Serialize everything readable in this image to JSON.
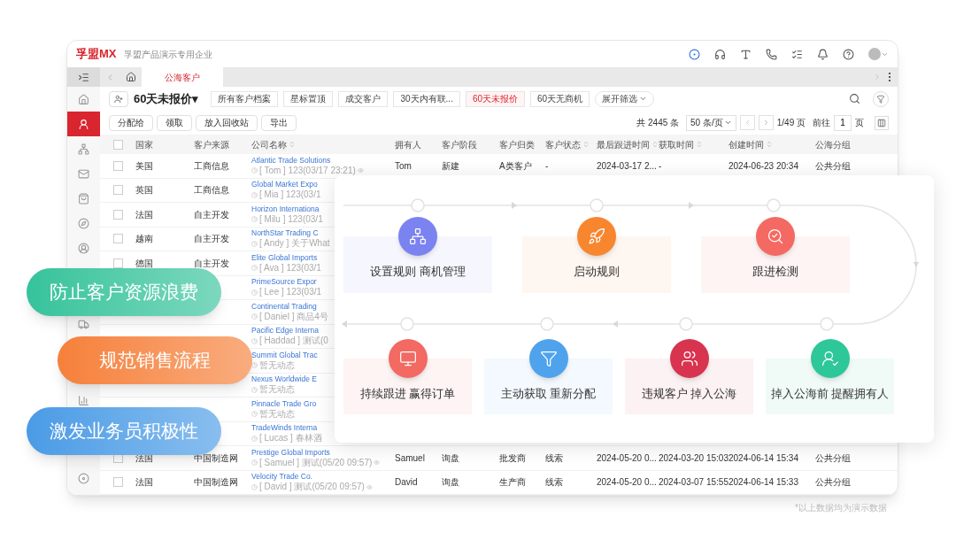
{
  "header": {
    "logo": "孚盟MX",
    "company": "孚盟产品演示专用企业"
  },
  "tabs": [
    {
      "label": "公海客户",
      "selected": true
    }
  ],
  "sidebar": {
    "items": [
      {
        "selected": false
      },
      {
        "selected": true
      },
      {
        "selected": false
      },
      {
        "selected": false
      },
      {
        "selected": false
      },
      {
        "selected": false
      },
      {
        "selected": false
      },
      {
        "selected": false
      },
      {
        "selected": false
      },
      {
        "selected": false
      }
    ]
  },
  "view": {
    "title": "60天未报价▾"
  },
  "chips": [
    {
      "label": "所有客户档案",
      "selected": false
    },
    {
      "label": "星标置顶",
      "selected": false
    },
    {
      "label": "成交客户",
      "selected": false
    },
    {
      "label": "30天内有联...",
      "selected": false
    },
    {
      "label": "60天未报价",
      "selected": true
    },
    {
      "label": "60天无商机",
      "selected": false
    }
  ],
  "expand_filter": "展开筛选",
  "actions": [
    "分配给",
    "领取",
    "放入回收站",
    "导出"
  ],
  "pagination": {
    "total": "共 2445 条",
    "per_page": "50 条/页",
    "pages": "1/49 页",
    "goto": "前往",
    "page": "1",
    "unit": "页"
  },
  "table": {
    "all_checked": false,
    "columns": [
      {
        "label": "国家",
        "sortable": false
      },
      {
        "label": "客户来源",
        "sortable": false
      },
      {
        "label": "公司名称",
        "sortable": true
      },
      {
        "label": "拥有人",
        "sortable": false
      },
      {
        "label": "客户阶段",
        "sortable": false
      },
      {
        "label": "客户归类",
        "sortable": false
      },
      {
        "label": "客户状态",
        "sortable": true
      },
      {
        "label": "最后跟进时间",
        "sortable": true
      },
      {
        "label": "获取时间",
        "sortable": true
      },
      {
        "label": "创建时间",
        "sortable": true
      },
      {
        "label": "公海分组",
        "sortable": false
      }
    ],
    "rows": [
      {
        "checked": false,
        "cells": [
          "美国",
          "工商信息",
          "Atlantic Trade Solutions",
          "Tom",
          "新建",
          "A类客户",
          "-",
          "2024-03-17 2...",
          "-",
          "2024-06-23 20:34",
          "公共分组"
        ],
        "note": "[ Tom ] 123(03/17 23:21)"
      },
      {
        "checked": false,
        "cells": [
          "英国",
          "工商信息",
          "Global Market Expo"
        ],
        "note": "[ Mia ] 123(03/1"
      },
      {
        "checked": false,
        "cells": [
          "法国",
          "自主开发",
          "Horizon Internationa"
        ],
        "note": "[ Milu ] 123(03/1"
      },
      {
        "checked": false,
        "cells": [
          "越南",
          "自主开发",
          "NorthStar Trading C"
        ],
        "note": "[ Andy ] 关于What"
      },
      {
        "checked": false,
        "cells": [
          "德国",
          "自主开发",
          "Elite Global Imports"
        ],
        "note": "[ Ava ] 123(03/1"
      },
      {
        "cells": [
          null,
          null,
          "PrimeSource Expor"
        ],
        "note": "[ Lee ] 123(03/1"
      },
      {
        "cells": [
          null,
          null,
          "Continental Trading"
        ],
        "note": "[ Daniel ] 商品4号"
      },
      {
        "cells": [
          null,
          null,
          "Pacific Edge Interna"
        ],
        "note": "[ Haddad ] 测试(0"
      },
      {
        "cells": [
          null,
          null,
          "Summit Global Trac"
        ],
        "note": "暂无动态"
      },
      {
        "cells": [
          null,
          null,
          "Nexus Worldwide E"
        ],
        "note": "暂无动态"
      },
      {
        "cells": [
          null,
          null,
          "Pinnacle Trade Gro"
        ],
        "note": "暂无动态"
      },
      {
        "cells": [
          null,
          null,
          "TradeWinds Interna"
        ],
        "note": "[ Lucas ] 春林酒"
      },
      {
        "checked": false,
        "cells": [
          "法国",
          "中国制造网",
          "Prestige Global Imports",
          "Samuel",
          "询盘",
          "批发商",
          "线索",
          "2024-05-20 0...",
          "2024-03-20 15:03",
          "2024-06-14 15:34",
          "公共分组"
        ],
        "note": "[ Samuel ] 测试(05/20 09:57)"
      },
      {
        "checked": false,
        "cells": [
          "法国",
          "中国制造网",
          "Velocity Trade Co.",
          "David",
          "询盘",
          "生产商",
          "线索",
          "2024-05-20 0...",
          "2024-03-07 15:55",
          "2024-06-14 15:33",
          "公共分组"
        ],
        "note": "[ David ] 测试(05/20 09:57)"
      }
    ]
  },
  "flow": {
    "top": [
      {
        "label": "设置规则 商机管理",
        "color": "#7b83f0"
      },
      {
        "label": "启动规则",
        "color": "#f7862f"
      },
      {
        "label": "跟进检测",
        "color": "#f46a63"
      }
    ],
    "bottom": [
      {
        "label": "持续跟进 赢得订单",
        "color": "#f26a62"
      },
      {
        "label": "主动获取 重新分配",
        "color": "#4fa3ec"
      },
      {
        "label": "违规客户  掉入公海",
        "color": "#d8334f"
      },
      {
        "label": "掉入公海前 提醒拥有人",
        "color": "#2ec79a"
      }
    ]
  },
  "highlights": [
    {
      "text": "防止客户资源浪费",
      "color": "#36c39b"
    },
    {
      "text": "规范销售流程",
      "color": "#f6803a"
    },
    {
      "text": "激发业务员积极性",
      "color": "#4a9be6"
    }
  ],
  "footnote": "*以上数据均为演示数据"
}
